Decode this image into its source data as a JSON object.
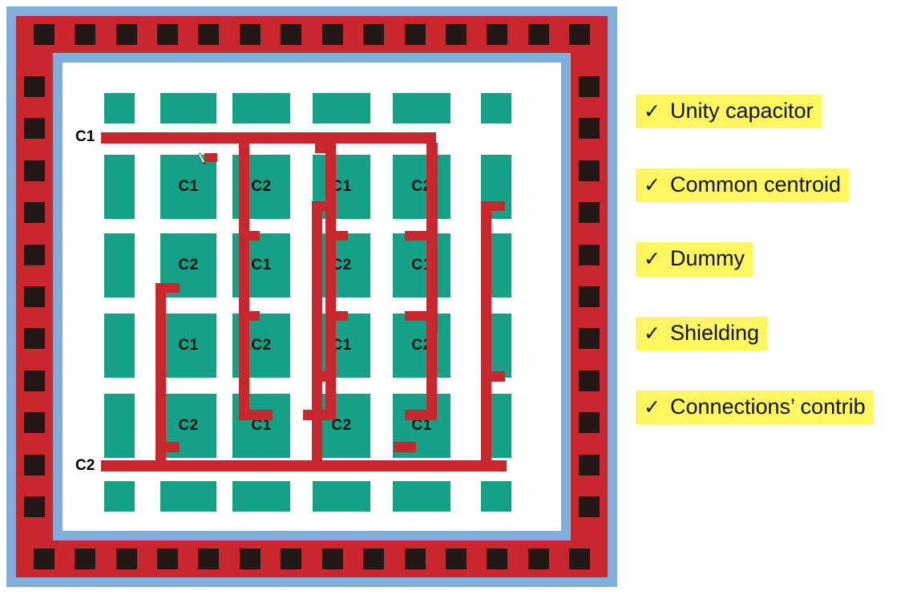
{
  "figure": {
    "name": "common-centroid-capacitor-array-layout",
    "colors": {
      "capacitor": "#16A085",
      "metal_route": "#C9272D",
      "shield": "#7FAEDB",
      "contact": "#231815",
      "well": "#FFFFFF"
    },
    "net_labels": [
      {
        "id": "c1-terminal",
        "text": "C1"
      },
      {
        "id": "c2-terminal",
        "text": "C2"
      }
    ],
    "grid": {
      "columns": 6,
      "rows": 6,
      "note_dummy": "",
      "cells": [
        [
          "",
          "",
          "",
          "",
          "",
          ""
        ],
        [
          "",
          "C1",
          "C2",
          "C1",
          "C2",
          ""
        ],
        [
          "",
          "C2",
          "C1",
          "C2",
          "C1",
          ""
        ],
        [
          "",
          "C1",
          "C2",
          "C1",
          "C2",
          ""
        ],
        [
          "",
          "C2",
          "C1",
          "C2",
          "C1",
          ""
        ],
        [
          "",
          "",
          "",
          "",
          "",
          ""
        ]
      ]
    },
    "ring_contacts": {
      "top_count": 14,
      "bottom_count": 14,
      "left_count": 13,
      "right_count": 13
    },
    "cursor": "pen-cursor"
  },
  "feature_list": {
    "check_glyph": "✓",
    "items": [
      {
        "label": "Unity capacitor"
      },
      {
        "label": "Common centroid"
      },
      {
        "label": "Dummy"
      },
      {
        "label": "Shielding"
      },
      {
        "label": "Connections’ contrib"
      }
    ]
  }
}
